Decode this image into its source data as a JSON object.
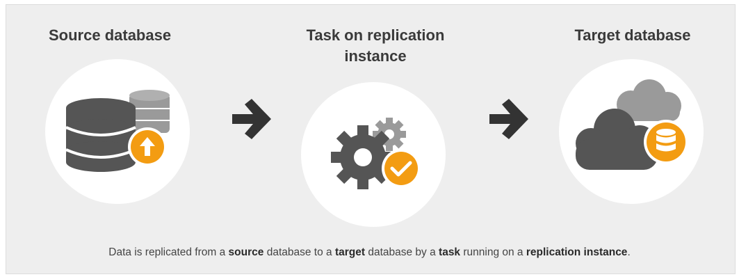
{
  "steps": [
    {
      "title_line1": "Source database",
      "title_line2": ""
    },
    {
      "title_line1": "Task on replication",
      "title_line2": "instance"
    },
    {
      "title_line1": "Target database",
      "title_line2": ""
    }
  ],
  "caption": {
    "t1": "Data is replicated from a ",
    "b1": "source",
    "t2": " database to a ",
    "b2": "target",
    "t3": " database by a ",
    "b3": "task",
    "t4": " running on a ",
    "b4": "replication instance",
    "t5": "."
  },
  "icons": {
    "source": "database-upload-icon",
    "task": "gears-check-icon",
    "target": "cloud-database-icon",
    "arrow": "arrow-right-icon"
  },
  "colors": {
    "panel_bg": "#eeeeee",
    "circle_bg": "#ffffff",
    "icon_dark": "#555555",
    "icon_light": "#9a9a9a",
    "accent": "#f39c12"
  }
}
